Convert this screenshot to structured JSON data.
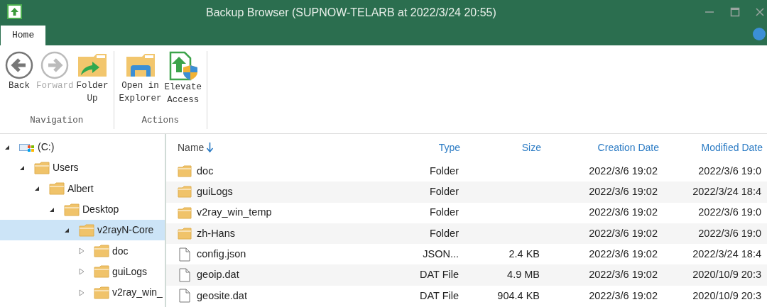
{
  "window": {
    "title": "Backup Browser (SUPNOW-TELARB at 2022/3/24 20:55)"
  },
  "tabs": [
    {
      "label": "Home",
      "selected": true
    }
  ],
  "ribbon": {
    "groups": [
      {
        "label": "Navigation",
        "buttons": [
          {
            "kind": "back",
            "label": "Back",
            "disabled": false
          },
          {
            "kind": "forward",
            "label": "Forward",
            "disabled": true
          },
          {
            "kind": "folder-up",
            "label": "Folder\nUp",
            "disabled": false
          }
        ]
      },
      {
        "label": "Actions",
        "buttons": [
          {
            "kind": "explorer",
            "label": "Open in\nExplorer",
            "disabled": false
          },
          {
            "kind": "elevate",
            "label": "Elevate\nAccess",
            "disabled": false
          }
        ]
      }
    ]
  },
  "tree": [
    {
      "label": "(C:)",
      "kind": "drive",
      "expanded": true,
      "selected": false,
      "children": [
        {
          "label": "Users",
          "kind": "folder",
          "expanded": true,
          "selected": false,
          "children": [
            {
              "label": "Albert",
              "kind": "folder",
              "expanded": true,
              "selected": false,
              "children": [
                {
                  "label": "Desktop",
                  "kind": "folder",
                  "expanded": true,
                  "selected": false,
                  "children": [
                    {
                      "label": "v2rayN-Core",
                      "kind": "folder",
                      "expanded": true,
                      "selected": true,
                      "children": [
                        {
                          "label": "doc",
                          "kind": "folder",
                          "expanded": false,
                          "selected": false
                        },
                        {
                          "label": "guiLogs",
                          "kind": "folder",
                          "expanded": false,
                          "selected": false
                        },
                        {
                          "label": "v2ray_win_",
                          "kind": "folder",
                          "expanded": false,
                          "selected": false
                        }
                      ]
                    }
                  ]
                }
              ]
            }
          ]
        }
      ]
    }
  ],
  "table": {
    "columns": [
      {
        "label": "Name",
        "sorted": true
      },
      {
        "label": "Type",
        "sorted": false
      },
      {
        "label": "Size",
        "sorted": false
      },
      {
        "label": "Creation Date",
        "sorted": false
      },
      {
        "label": "Modified Date",
        "sorted": false
      }
    ],
    "rows": [
      {
        "kind": "folder",
        "cells": [
          "doc",
          "Folder",
          "",
          "2022/3/6 19:02",
          "2022/3/6 19:0"
        ]
      },
      {
        "kind": "folder",
        "cells": [
          "guiLogs",
          "Folder",
          "",
          "2022/3/6 19:02",
          "2022/3/24 18:4"
        ]
      },
      {
        "kind": "folder",
        "cells": [
          "v2ray_win_temp",
          "Folder",
          "",
          "2022/3/6 19:02",
          "2022/3/6 19:0"
        ]
      },
      {
        "kind": "folder",
        "cells": [
          "zh-Hans",
          "Folder",
          "",
          "2022/3/6 19:02",
          "2022/3/6 19:0"
        ]
      },
      {
        "kind": "file",
        "cells": [
          "config.json",
          "JSON...",
          "2.4 KB",
          "2022/3/6 19:02",
          "2022/3/24 18:4"
        ]
      },
      {
        "kind": "file",
        "cells": [
          "geoip.dat",
          "DAT File",
          "4.9 MB",
          "2022/3/6 19:02",
          "2020/10/9 20:3"
        ]
      },
      {
        "kind": "file",
        "cells": [
          "geosite.dat",
          "DAT File",
          "904.4 KB",
          "2022/3/6 19:02",
          "2020/10/9 20:3"
        ]
      }
    ]
  }
}
